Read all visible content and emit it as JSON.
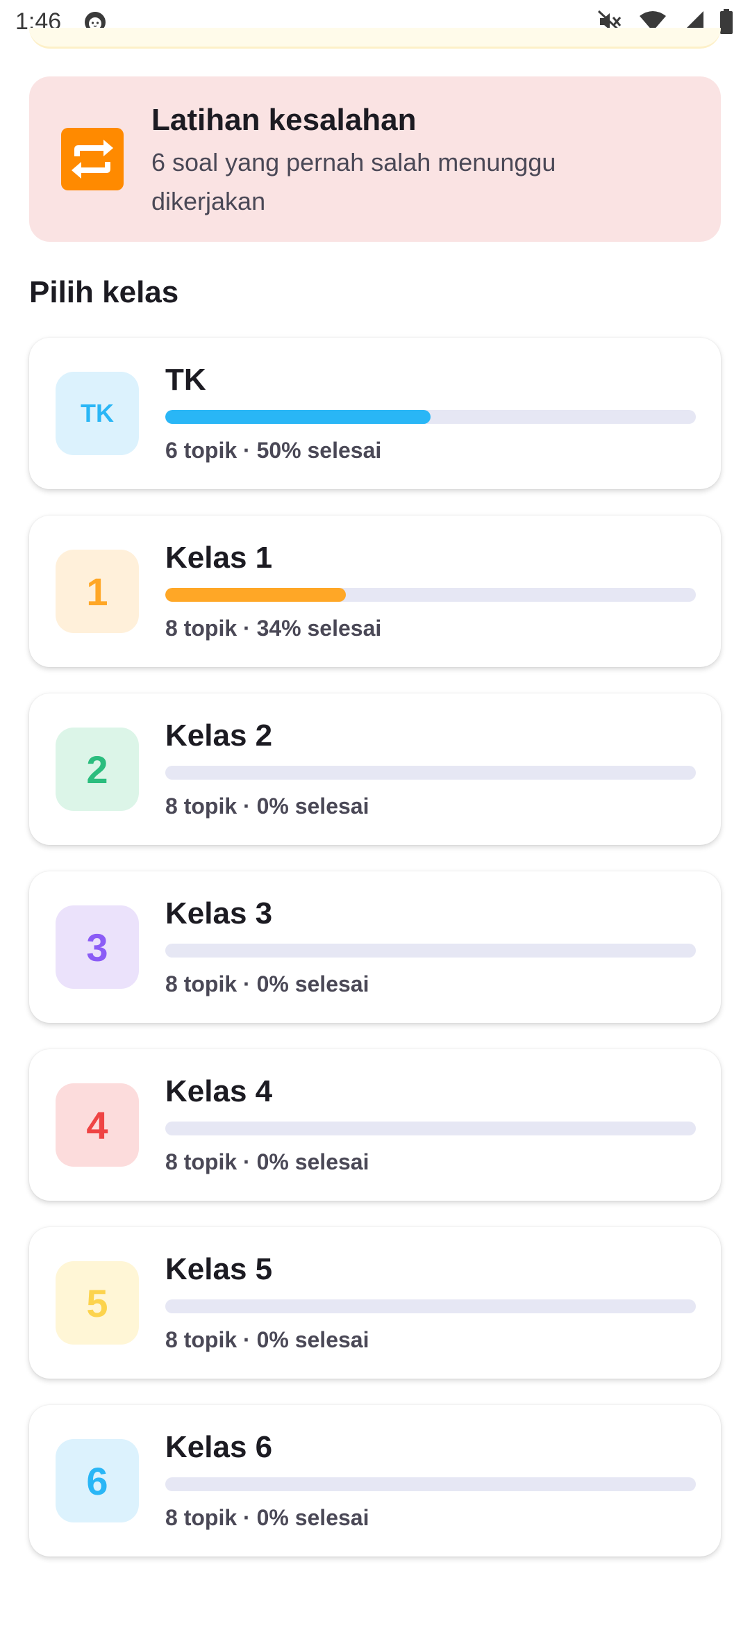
{
  "status_bar": {
    "time": "1:46"
  },
  "practice": {
    "icon": "repeat-icon",
    "title": "Latihan kesalahan",
    "subtitle": "6 soal yang pernah salah menunggu dikerjakan",
    "background": "#fae3e3"
  },
  "section_title": "Pilih kelas",
  "classes": [
    {
      "badge": "TK",
      "name": "TK",
      "meta": "6 topik · 50% selesai",
      "progress": 0.5,
      "accent": "#29b6f6",
      "badge_bg": "#dcf2fd",
      "badge_color": "#29b6f6"
    },
    {
      "badge": "1",
      "name": "Kelas 1",
      "meta": "8 topik · 34% selesai",
      "progress": 0.34,
      "accent": "#ffa726",
      "badge_bg": "#fff0da",
      "badge_color": "#ffa726"
    },
    {
      "badge": "2",
      "name": "Kelas 2",
      "meta": "8 topik · 0% selesai",
      "progress": 0,
      "accent": "#2bbd7e",
      "badge_bg": "#dcf5e8",
      "badge_color": "#2bbd7e"
    },
    {
      "badge": "3",
      "name": "Kelas 3",
      "meta": "8 topik · 0% selesai",
      "progress": 0,
      "accent": "#8b5cf6",
      "badge_bg": "#ebe2fb",
      "badge_color": "#8b5cf6"
    },
    {
      "badge": "4",
      "name": "Kelas 4",
      "meta": "8 topik · 0% selesai",
      "progress": 0,
      "accent": "#ef4444",
      "badge_bg": "#fcdcdc",
      "badge_color": "#ef4444"
    },
    {
      "badge": "5",
      "name": "Kelas 5",
      "meta": "8 topik · 0% selesai",
      "progress": 0,
      "accent": "#fcd34d",
      "badge_bg": "#fff6d6",
      "badge_color": "#fcd34d"
    },
    {
      "badge": "6",
      "name": "Kelas 6",
      "meta": "8 topik · 0% selesai",
      "progress": 0,
      "accent": "#29b6f6",
      "badge_bg": "#dcf2fd",
      "badge_color": "#29b6f6"
    }
  ]
}
